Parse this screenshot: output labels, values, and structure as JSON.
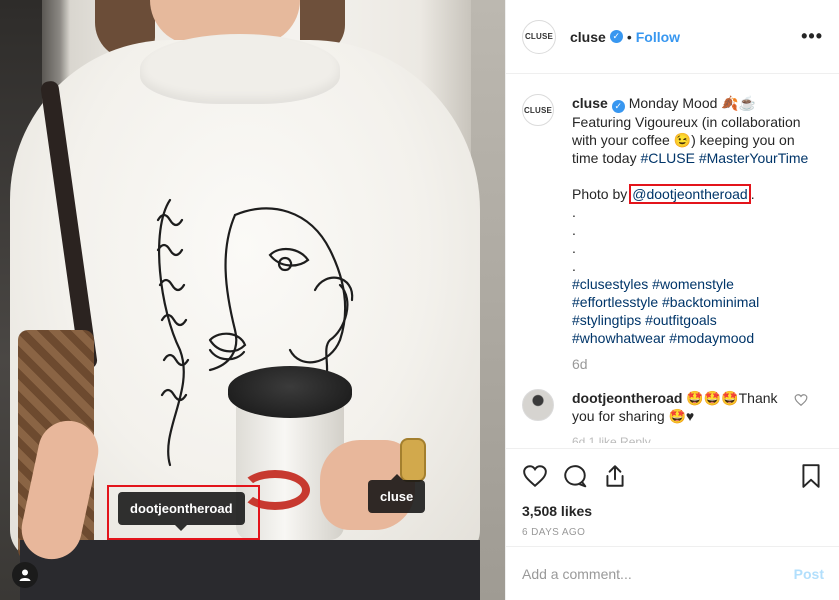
{
  "photo": {
    "tags": [
      {
        "username": "dootjeontheroad"
      },
      {
        "username": "cluse"
      }
    ]
  },
  "header": {
    "avatar_text": "CLUSE",
    "username": "cluse",
    "separator": "•",
    "follow_label": "Follow",
    "more_label": "•••"
  },
  "caption": {
    "avatar_text": "CLUSE",
    "username": "cluse",
    "text_lines": [
      "Monday Mood 🍂☕",
      "Featuring Vigoureux (in collaboration",
      "with your coffee 😉) keeping you on",
      "time today"
    ],
    "inline_hashtags": [
      "#CLUSE",
      "#MasterYourTime"
    ],
    "photo_by_label": "Photo by",
    "photo_by_mention": "@dootjeontheroad",
    "photo_by_suffix": ".",
    "dots": [
      ".",
      ".",
      ".",
      "."
    ],
    "hashtag_lines": [
      [
        "#clusestyles",
        "#womenstyle"
      ],
      [
        "#effortlesstyle",
        "#backtominimal"
      ],
      [
        "#stylingtips",
        "#outfitgoals"
      ],
      [
        "#whowhatwear",
        "#modaymood"
      ]
    ],
    "age": "6d"
  },
  "comment": {
    "username": "dootjeontheroad",
    "text": "🤩🤩🤩Thank you for sharing 🤩♥",
    "cut_text": "6d   1 like   Reply"
  },
  "actions": {
    "likes": "3,508 likes",
    "date": "6 DAYS AGO"
  },
  "add_comment": {
    "placeholder": "Add a comment...",
    "post_label": "Post"
  },
  "colors": {
    "link_blue": "#3897f0",
    "hashtag": "#003569",
    "highlight_red": "#e3141b",
    "post_disabled": "#b2dffc"
  }
}
